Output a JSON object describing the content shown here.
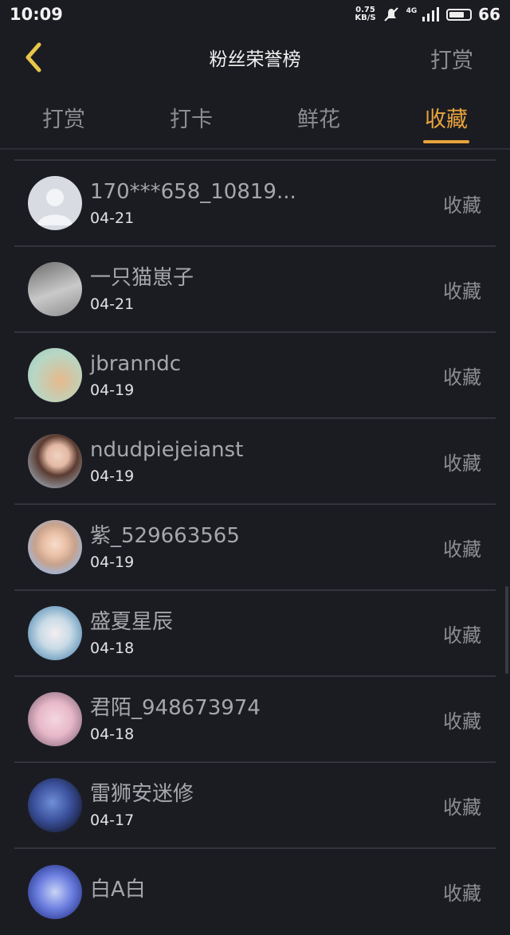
{
  "status": {
    "time": "10:09",
    "net_speed_top": "0.75",
    "net_speed_bottom": "KB/S",
    "signal": "4G",
    "battery": "66"
  },
  "nav": {
    "title": "粉丝荣誉榜",
    "right": "打赏"
  },
  "tabs": [
    {
      "label": "打赏"
    },
    {
      "label": "打卡"
    },
    {
      "label": "鲜花"
    },
    {
      "label": "收藏"
    }
  ],
  "rows": [
    {
      "name": "170***658_10819...",
      "date": "04-21",
      "action": "收藏"
    },
    {
      "name": "一只猫崽子",
      "date": "04-21",
      "action": "收藏"
    },
    {
      "name": "jbranndc",
      "date": "04-19",
      "action": "收藏"
    },
    {
      "name": "ndudpiejeianst",
      "date": "04-19",
      "action": "收藏"
    },
    {
      "name": "紫_529663565",
      "date": "04-19",
      "action": "收藏"
    },
    {
      "name": "盛夏星辰",
      "date": "04-18",
      "action": "收藏"
    },
    {
      "name": "君陌_948673974",
      "date": "04-18",
      "action": "收藏"
    },
    {
      "name": "雷狮安迷修",
      "date": "04-17",
      "action": "收藏"
    },
    {
      "name": "白A白",
      "date": "",
      "action": "收藏"
    }
  ],
  "colors": {
    "accent": "#e8a33c",
    "background": "#1b1c22"
  }
}
